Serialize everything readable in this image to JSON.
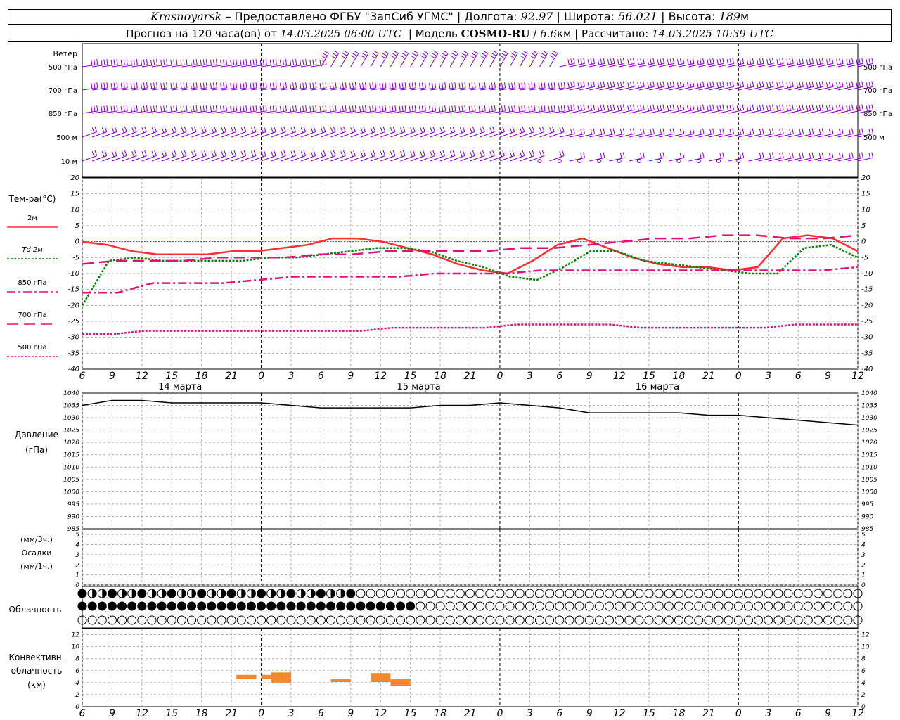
{
  "header": {
    "station": "Krasnoyarsk",
    "provider": "– Предоставлено ФГБУ \"ЗапСиб УГМС\"",
    "lon_label": "Долгота:",
    "lon": "92.97",
    "lat_label": "Широта:",
    "lat": "56.021",
    "alt_label": "Высота:",
    "alt": "189",
    "alt_unit": "м",
    "forecast_prefix": "Прогноз на 120 часа(ов) от",
    "init_time": "14.03.2025 06:00 UTC",
    "model_label": "Модель",
    "model": "COSMO-RU",
    "model_res": "6.6",
    "model_res_unit": "км",
    "calc_label": "Рассчитано:",
    "calc_time": "14.03.2025 10:39 UTC"
  },
  "wind": {
    "title": "Ветер",
    "levels": [
      "500 гПа",
      "700 гПа",
      "850 гПа",
      "500 м",
      "10  м"
    ],
    "color": "#8000c0"
  },
  "time_axis": {
    "ticks": [
      "6",
      "9",
      "12",
      "15",
      "18",
      "21",
      "0",
      "3",
      "6",
      "9",
      "12",
      "15",
      "18",
      "21",
      "0",
      "3",
      "6",
      "9",
      "12",
      "15",
      "18",
      "21",
      "0",
      "3",
      "6",
      "9",
      "12"
    ],
    "days": [
      "14 марта",
      "15 марта",
      "16 марта"
    ]
  },
  "temperature": {
    "title": "Тем-ра(°С)",
    "legend": [
      {
        "label": "2м",
        "color": "#ff3030",
        "style": "solid"
      },
      {
        "label": "Td  2м",
        "color": "#008000",
        "style": "dotted"
      },
      {
        "label": "850 гПа",
        "color": "#e0107a",
        "style": "dashdot"
      },
      {
        "label": "700 гПа",
        "color": "#e0107a",
        "style": "dashed"
      },
      {
        "label": "500 гПа",
        "color": "#e0107a",
        "style": "dotted"
      }
    ]
  },
  "pressure": {
    "title": "Давление",
    "unit": "(гПа)"
  },
  "precip": {
    "unit1": "(мм/3ч.)",
    "title": "Осадки",
    "unit2": "(мм/1ч.)"
  },
  "cloud": {
    "title": "Облачность"
  },
  "conv": {
    "title1": "Конвективн.",
    "title2": "облачность",
    "unit": "(км)",
    "color": "#f08a30"
  },
  "chart_data": [
    {
      "type": "line",
      "title": "Тем-ра(°С)",
      "ylim": [
        -40,
        20
      ],
      "x_hours": [
        0,
        3,
        6,
        9,
        12,
        15,
        18,
        21,
        24,
        27,
        30,
        33,
        36,
        39,
        42,
        45,
        48,
        51,
        54,
        57,
        60,
        63,
        66,
        69,
        72,
        75,
        78
      ],
      "series": [
        {
          "name": "2м",
          "values": [
            0,
            -1,
            -3,
            -4,
            -4,
            -4,
            -3,
            -3,
            -2,
            -1,
            1,
            1,
            0,
            -2,
            -4,
            -7,
            -9,
            -10,
            -6,
            -1,
            1,
            -2,
            -5,
            -7,
            -8,
            -8,
            -9,
            -8,
            1,
            2,
            1,
            -3
          ]
        },
        {
          "name": "Td  2м",
          "values": [
            -20,
            -6,
            -5,
            -6,
            -6,
            -6,
            -6,
            -5,
            -5,
            -4,
            -3,
            -2,
            -2,
            -3,
            -6,
            -8,
            -11,
            -12,
            -8,
            -3,
            -3,
            -6,
            -7,
            -8,
            -9,
            -10,
            -10,
            -2,
            -1,
            -5
          ]
        },
        {
          "name": "850 гПа",
          "values": [
            -16,
            -16,
            -13,
            -13,
            -13,
            -12,
            -11,
            -11,
            -11,
            -11,
            -10,
            -10,
            -10,
            -9,
            -9,
            -9,
            -9,
            -9,
            -9,
            -9,
            -9,
            -9,
            -8
          ]
        },
        {
          "name": "700 гПа",
          "values": [
            -7,
            -6,
            -6,
            -6,
            -5,
            -5,
            -5,
            -4,
            -4,
            -3,
            -3,
            -3,
            -3,
            -2,
            -2,
            -1,
            0,
            1,
            1,
            2,
            2,
            1,
            1,
            2
          ]
        },
        {
          "name": "500 гПа",
          "values": [
            -29,
            -29,
            -28,
            -28,
            -28,
            -28,
            -28,
            -28,
            -28,
            -28,
            -27,
            -27,
            -27,
            -27,
            -26,
            -26,
            -26,
            -26,
            -27,
            -27,
            -27,
            -27,
            -27,
            -26,
            -26,
            -26
          ]
        }
      ]
    },
    {
      "type": "line",
      "title": "Давление",
      "ylabel": "(гПа)",
      "ylim": [
        985,
        1040
      ],
      "series": [
        {
          "name": "Давление",
          "values": [
            1035,
            1037,
            1037,
            1036,
            1036,
            1036,
            1036,
            1035,
            1034,
            1034,
            1034,
            1034,
            1035,
            1035,
            1036,
            1035,
            1034,
            1032,
            1032,
            1032,
            1032,
            1031,
            1031,
            1030,
            1029,
            1028,
            1027
          ]
        }
      ]
    },
    {
      "type": "bar",
      "title": "Конвективн. облачность",
      "ylabel": "(км)",
      "ylim": [
        0,
        13
      ],
      "series": [
        {
          "name": "Конвективн. облачность",
          "values": [
            [
              15.5,
              4.6,
              5.3
            ],
            [
              18,
              4.6,
              5.3
            ],
            [
              19,
              4,
              5.7
            ],
            [
              25,
              4.1,
              4.6
            ],
            [
              29,
              4.1,
              5.6
            ],
            [
              31,
              3.5,
              4.6
            ]
          ]
        }
      ]
    }
  ]
}
